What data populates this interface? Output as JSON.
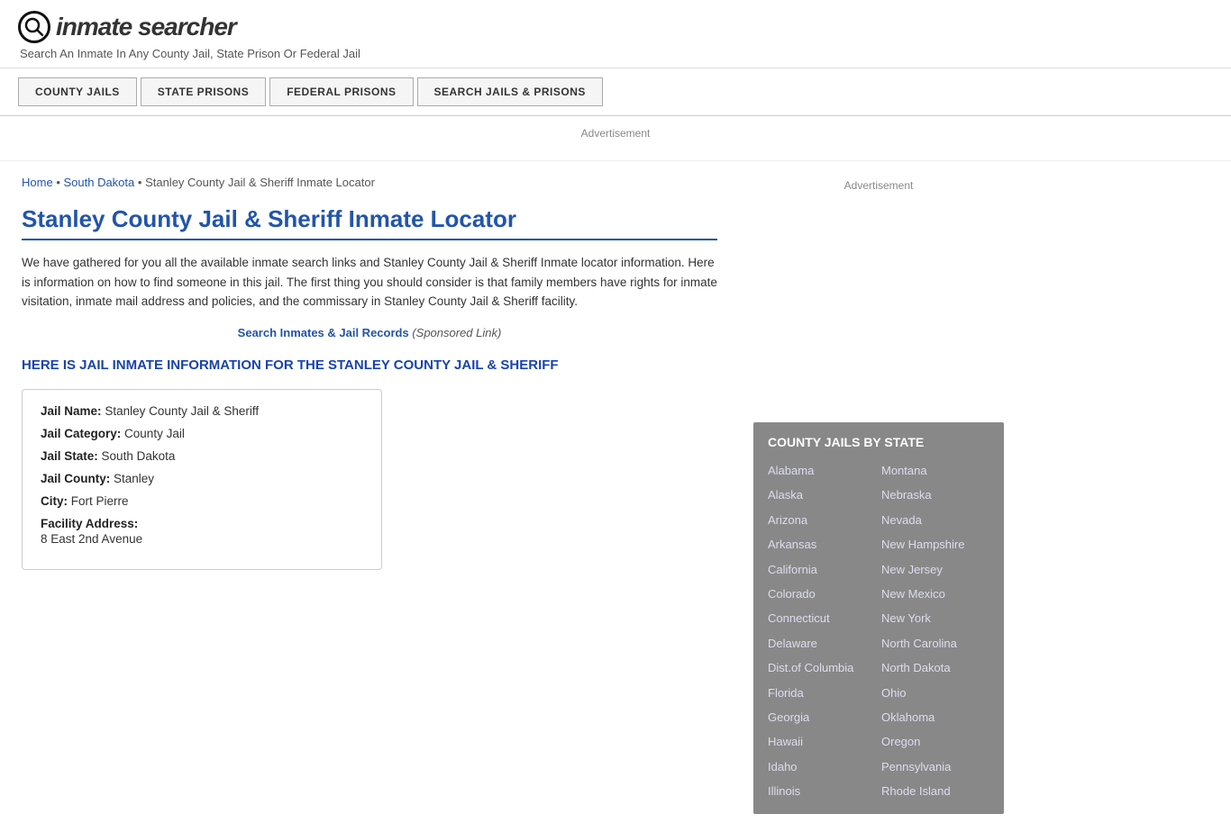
{
  "header": {
    "logo_icon": "🔍",
    "logo_text": "inmate searcher",
    "tagline": "Search An Inmate In Any County Jail, State Prison Or Federal Jail"
  },
  "nav": {
    "buttons": [
      {
        "label": "COUNTY JAILS",
        "id": "county-jails-btn"
      },
      {
        "label": "STATE PRISONS",
        "id": "state-prisons-btn"
      },
      {
        "label": "FEDERAL PRISONS",
        "id": "federal-prisons-btn"
      },
      {
        "label": "SEARCH JAILS & PRISONS",
        "id": "search-jails-btn"
      }
    ]
  },
  "ad_label": "Advertisement",
  "breadcrumb": {
    "home": "Home",
    "state": "South Dakota",
    "current": "Stanley County Jail & Sheriff Inmate Locator"
  },
  "page_title": "Stanley County Jail & Sheriff Inmate Locator",
  "description": "We have gathered for you all the available inmate search links and Stanley County Jail & Sheriff Inmate locator information. Here is information on how to find someone in this jail. The first thing you should consider is that family members have rights for inmate visitation, inmate mail address and policies, and the commissary in Stanley County Jail & Sheriff facility.",
  "sponsored": {
    "link_text": "Search Inmates & Jail Records",
    "suffix": "(Sponsored Link)"
  },
  "section_heading": "HERE IS JAIL INMATE INFORMATION FOR THE STANLEY COUNTY JAIL & SHERIFF",
  "info": {
    "jail_name_label": "Jail Name:",
    "jail_name_value": "Stanley County Jail & Sheriff",
    "jail_category_label": "Jail Category:",
    "jail_category_value": "County Jail",
    "jail_state_label": "Jail State:",
    "jail_state_value": "South Dakota",
    "jail_county_label": "Jail County:",
    "jail_county_value": "Stanley",
    "city_label": "City:",
    "city_value": "Fort Pierre",
    "address_label": "Facility Address:",
    "address_value": "8 East 2nd Avenue"
  },
  "sidebar": {
    "ad_label": "Advertisement",
    "county_jails_title": "COUNTY JAILS BY STATE",
    "states_left": [
      "Alabama",
      "Alaska",
      "Arizona",
      "Arkansas",
      "California",
      "Colorado",
      "Connecticut",
      "Delaware",
      "Dist.of Columbia",
      "Florida",
      "Georgia",
      "Hawaii",
      "Idaho",
      "Illinois"
    ],
    "states_right": [
      "Montana",
      "Nebraska",
      "Nevada",
      "New Hampshire",
      "New Jersey",
      "New Mexico",
      "New York",
      "North Carolina",
      "North Dakota",
      "Ohio",
      "Oklahoma",
      "Oregon",
      "Pennsylvania",
      "Rhode Island"
    ]
  }
}
